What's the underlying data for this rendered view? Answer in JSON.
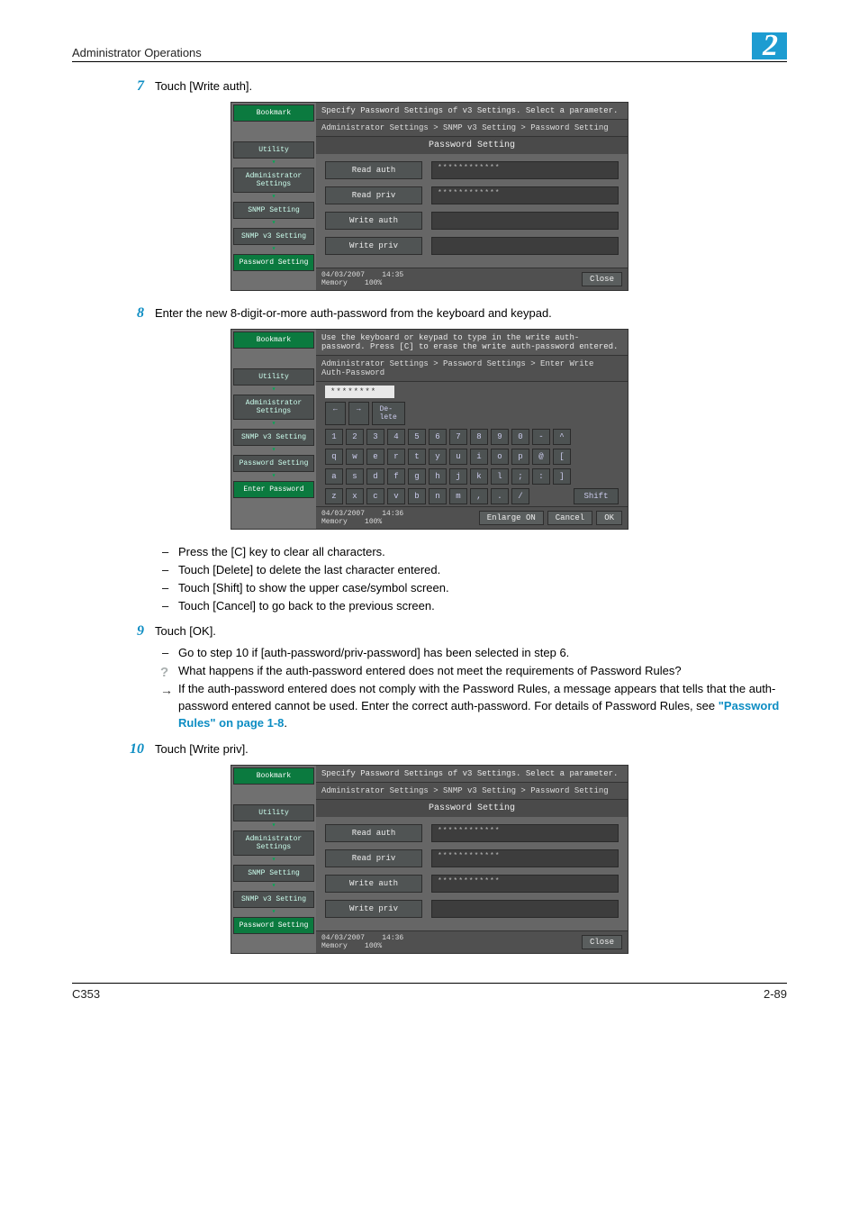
{
  "header": {
    "title": "Administrator Operations",
    "chapter": "2"
  },
  "steps": {
    "s7": {
      "num": "7",
      "text": "Touch [Write auth]."
    },
    "s8": {
      "num": "8",
      "text": "Enter the new 8-digit-or-more auth-password from the keyboard and keypad."
    },
    "s9": {
      "num": "9",
      "text": "Touch [OK]."
    },
    "s10": {
      "num": "10",
      "text": "Touch [Write priv]."
    }
  },
  "bullets8": [
    "Press the [C] key to clear all characters.",
    "Touch [Delete] to delete the last character entered.",
    "Touch [Shift] to show the upper case/symbol screen.",
    "Touch [Cancel] to go back to the previous screen."
  ],
  "bullets9": {
    "b1": "Go to step 10 if [auth-password/priv-password] has been selected in step 6.",
    "q": "What happens if the auth-password entered does not meet the requirements of Password Rules?",
    "a_pre": "If the auth-password entered does not comply with the Password Rules, a message appears that tells that the auth-password entered cannot be used. Enter the correct auth-password. For details of Password Rules, see ",
    "a_link": "\"Password Rules\" on page 1-8",
    "a_post": "."
  },
  "shot1": {
    "header": "Specify Password Settings of v3 Settings. Select a parameter.",
    "breadcrumb": "Administrator Settings > SNMP v3 Setting > Password Setting",
    "subtitle": "Password Setting",
    "side": {
      "bookmark": "Bookmark",
      "utility": "Utility",
      "admin": "Administrator Settings",
      "snmp": "SNMP Setting",
      "snmpv3": "SNMP v3 Setting",
      "password": "Password Setting"
    },
    "opts": {
      "read_auth": "Read auth",
      "read_priv": "Read priv",
      "write_auth": "Write auth",
      "write_priv": "Write priv",
      "mask1": "************",
      "mask2": "************"
    },
    "footer": {
      "date": "04/03/2007",
      "time": "14:35",
      "mem": "Memory",
      "pct": "100%",
      "close": "Close"
    }
  },
  "shot2": {
    "header": "Use the keyboard or keypad to type in the write auth-password. Press [C] to erase the write auth-password entered.",
    "breadcrumb": "Administrator Settings > Password Settings > Enter Write Auth-Password",
    "input": "********",
    "side": {
      "bookmark": "Bookmark",
      "utility": "Utility",
      "admin": "Administrator Settings",
      "snmpv3": "SNMP v3 Setting",
      "password": "Password Setting",
      "enter": "Enter Password"
    },
    "kb": {
      "left": "←",
      "right": "→",
      "delete": "De-\nlete",
      "shift": "Shift",
      "enlarge": "Enlarge ON",
      "cancel": "Cancel",
      "ok": "OK",
      "row1": [
        "1",
        "2",
        "3",
        "4",
        "5",
        "6",
        "7",
        "8",
        "9",
        "0",
        "-",
        "^"
      ],
      "row2": [
        "q",
        "w",
        "e",
        "r",
        "t",
        "y",
        "u",
        "i",
        "o",
        "p",
        "@",
        "["
      ],
      "row3": [
        "a",
        "s",
        "d",
        "f",
        "g",
        "h",
        "j",
        "k",
        "l",
        ";",
        ":",
        "]"
      ],
      "row4": [
        "z",
        "x",
        "c",
        "v",
        "b",
        "n",
        "m",
        ",",
        ".",
        "/"
      ]
    },
    "footer": {
      "date": "04/03/2007",
      "time": "14:36",
      "mem": "Memory",
      "pct": "100%"
    }
  },
  "shot3": {
    "header": "Specify Password Settings of v3 Settings. Select a parameter.",
    "breadcrumb": "Administrator Settings > SNMP v3 Setting > Password Setting",
    "subtitle": "Password Setting",
    "side": {
      "bookmark": "Bookmark",
      "utility": "Utility",
      "admin": "Administrator Settings",
      "snmp": "SNMP Setting",
      "snmpv3": "SNMP v3 Setting",
      "password": "Password Setting"
    },
    "opts": {
      "read_auth": "Read auth",
      "read_priv": "Read priv",
      "write_auth": "Write auth",
      "write_priv": "Write priv",
      "mask1": "************",
      "mask2": "************",
      "mask3": "************"
    },
    "footer": {
      "date": "04/03/2007",
      "time": "14:36",
      "mem": "Memory",
      "pct": "100%",
      "close": "Close"
    }
  },
  "pagefoot": {
    "left": "C353",
    "right": "2-89"
  }
}
